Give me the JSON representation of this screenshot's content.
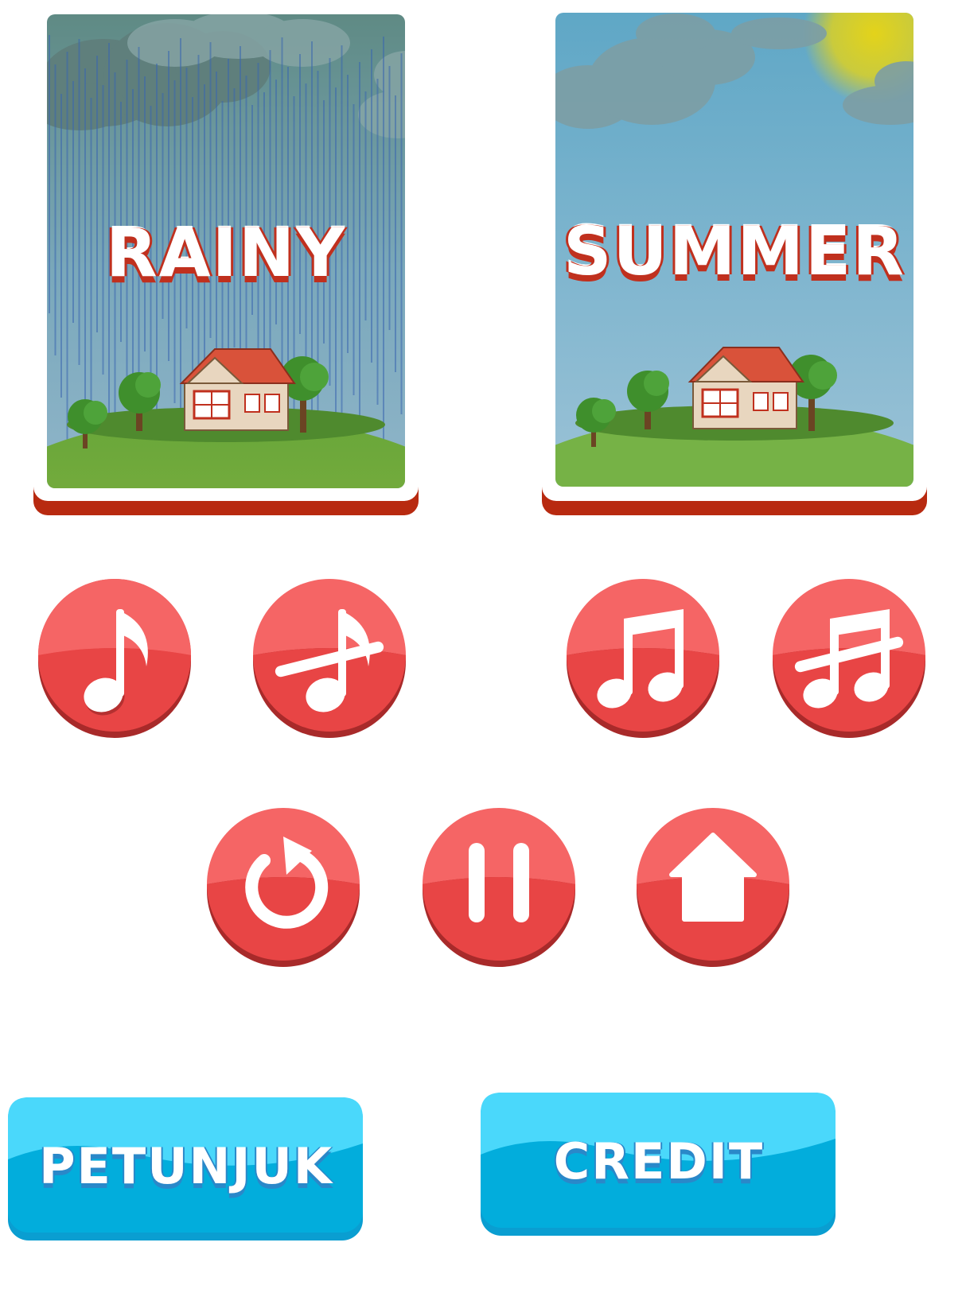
{
  "cards": [
    {
      "title": "RAINY",
      "theme": "rainy"
    },
    {
      "title": "SUMMER",
      "theme": "summer"
    }
  ],
  "buttons": {
    "petunjuk_label": "PETUNJUK",
    "credit_label": "CREDIT"
  },
  "colors": {
    "red_button": "#f45a5a",
    "red_button_dark": "#a82a2a",
    "blue_button": "#4ad8fb",
    "blue_button_dark": "#0a9ed1",
    "card_border": "#b82a10"
  },
  "icons": [
    "music-note-icon",
    "music-note-off-icon",
    "music-notes-icon",
    "music-notes-off-icon",
    "restart-icon",
    "pause-icon",
    "home-icon"
  ]
}
